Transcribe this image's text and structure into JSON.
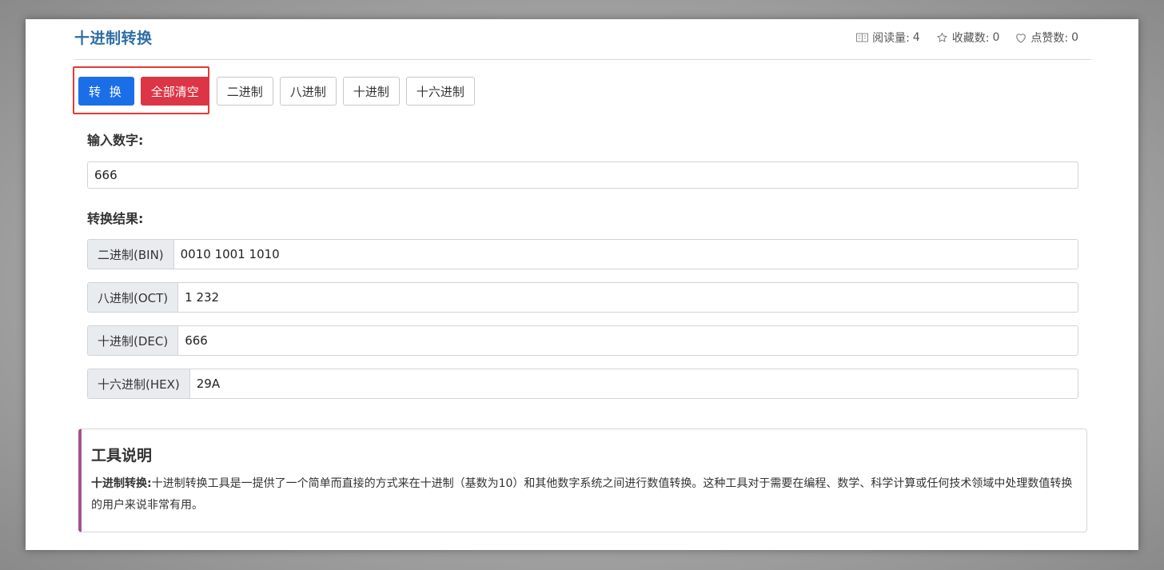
{
  "header": {
    "title": "十进制转换",
    "stats": {
      "views_label": "阅读量:",
      "views_value": "4",
      "favorites_label": "收藏数:",
      "favorites_value": "0",
      "likes_label": "点赞数:",
      "likes_value": "0"
    }
  },
  "toolbar": {
    "convert_label": "转 换",
    "clear_label": "全部清空",
    "binary_label": "二进制",
    "octal_label": "八进制",
    "decimal_label": "十进制",
    "hex_label": "十六进制"
  },
  "input": {
    "label": "输入数字:",
    "value": "666"
  },
  "results": {
    "label": "转换结果:",
    "rows": [
      {
        "label": "二进制(BIN)",
        "value": "0010 1001 1010"
      },
      {
        "label": "八进制(OCT)",
        "value": "1 232"
      },
      {
        "label": "十进制(DEC)",
        "value": "666"
      },
      {
        "label": "十六进制(HEX)",
        "value": "29A"
      }
    ]
  },
  "info": {
    "title": "工具说明",
    "lead": "十进制转换:",
    "body": "十进制转换工具是一提供了一个简单而直接的方式来在十进制（基数为10）和其他数字系统之间进行数值转换。这种工具对于需要在编程、数学、科学计算或任何技术领域中处理数值转换的用户来说非常有用。"
  },
  "colors": {
    "title": "#2f6ea4",
    "primary": "#1a6fe8",
    "danger": "#dc3545",
    "highlight": "#e53935",
    "card_accent": "#a0548e"
  },
  "icons": {
    "views": "book-icon",
    "favorites": "star-icon",
    "likes": "heart-icon"
  }
}
